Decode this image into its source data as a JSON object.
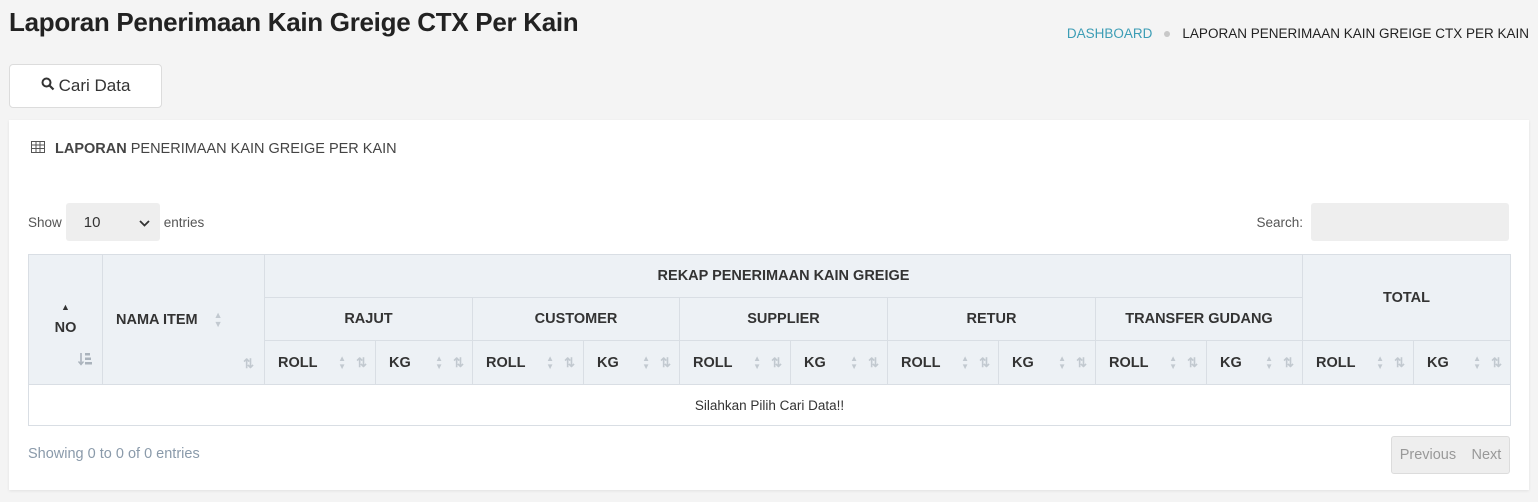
{
  "header": {
    "title": "Laporan Penerimaan Kain Greige CTX Per Kain",
    "breadcrumb": {
      "home": "DASHBOARD",
      "current": "LAPORAN PENERIMAAN KAIN GREIGE CTX PER KAIN"
    }
  },
  "toolbar": {
    "search_button_label": "Cari Data",
    "search_icon": "search-icon"
  },
  "panel": {
    "title_bold": "LAPORAN",
    "title_rest": "PENERIMAAN KAIN GREIGE PER KAIN",
    "icon": "table-icon"
  },
  "table_controls": {
    "show_label": "Show",
    "entries_value": "10",
    "entries_label": "entries",
    "search_label": "Search:",
    "search_value": ""
  },
  "table": {
    "col_no": "NO",
    "col_nama_item": "NAMA ITEM",
    "group_rekap": "REKAP PENERIMAAN KAIN GREIGE",
    "group_total": "TOTAL",
    "groups": [
      "RAJUT",
      "CUSTOMER",
      "SUPPLIER",
      "RETUR",
      "TRANSFER GUDANG"
    ],
    "sub_roll": "ROLL",
    "sub_kg": "KG",
    "empty_message": "Silahkan Pilih Cari Data!!"
  },
  "footer": {
    "info": "Showing 0 to 0 of 0 entries",
    "prev_label": "Previous",
    "next_label": "Next"
  },
  "colors": {
    "accent_link": "#3c9db5",
    "header_bg": "#edf1f5",
    "border": "#d9dee4"
  }
}
